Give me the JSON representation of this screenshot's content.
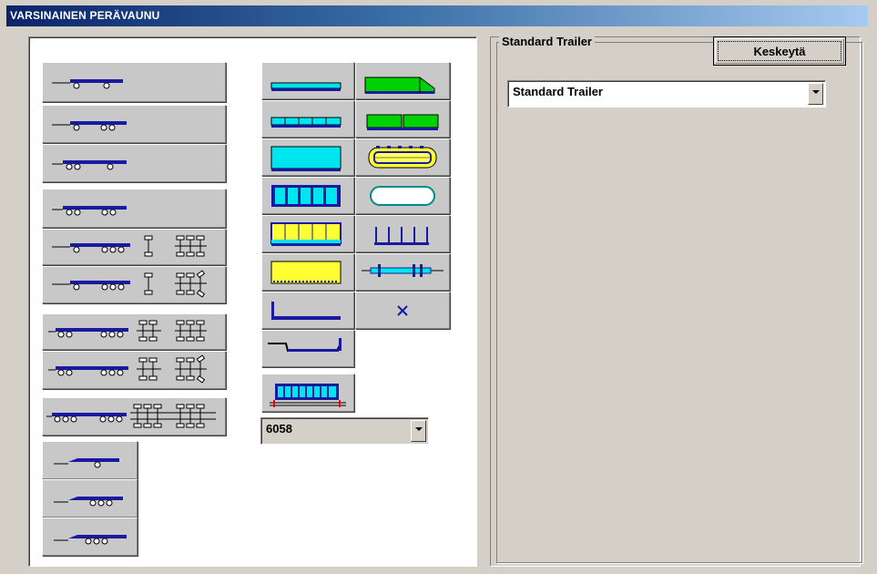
{
  "window": {
    "title": "VARSINAINEN PERÄVAUNU"
  },
  "right_panel": {
    "group_caption": "Standard Trailer",
    "cancel_label": "Keskeytä",
    "trailer_select": {
      "value": "Standard Trailer"
    }
  },
  "left_panel": {
    "length_select": {
      "value": "6058"
    },
    "axle_buttons": [
      {
        "name": "axle-config-1-1"
      },
      {
        "name": "axle-config-1-2"
      },
      {
        "name": "axle-config-2-1"
      },
      {
        "name": "axle-config-2-2"
      },
      {
        "name": "axle-config-1-3-wheels"
      },
      {
        "name": "axle-config-1-3-steer"
      },
      {
        "name": "axle-config-2-3-wheels"
      },
      {
        "name": "axle-config-2-3-steer"
      },
      {
        "name": "axle-config-3-3-wheels"
      },
      {
        "name": "drawbar-1"
      },
      {
        "name": "drawbar-2"
      },
      {
        "name": "drawbar-3"
      }
    ],
    "body_buttons": [
      {
        "name": "body-flatbed"
      },
      {
        "name": "body-flatbed-sections"
      },
      {
        "name": "body-box"
      },
      {
        "name": "body-box-sections"
      },
      {
        "name": "body-curtain"
      },
      {
        "name": "body-tipper"
      },
      {
        "name": "body-lowbed"
      },
      {
        "name": "body-stepframe"
      },
      {
        "name": "body-tractor-cab"
      },
      {
        "name": "body-two-containers"
      },
      {
        "name": "body-tank-yellow"
      },
      {
        "name": "body-tank-white"
      },
      {
        "name": "body-stakes"
      },
      {
        "name": "body-timber-frame"
      },
      {
        "name": "body-none"
      },
      {
        "name": "body-container-frame"
      }
    ]
  },
  "colors": {
    "title_start": "#0a246a",
    "title_end": "#a6caf0",
    "trailer_blue": "#1a1aa0",
    "cyan": "#00e5ee",
    "green": "#00d200",
    "yellow": "#ffff33"
  }
}
